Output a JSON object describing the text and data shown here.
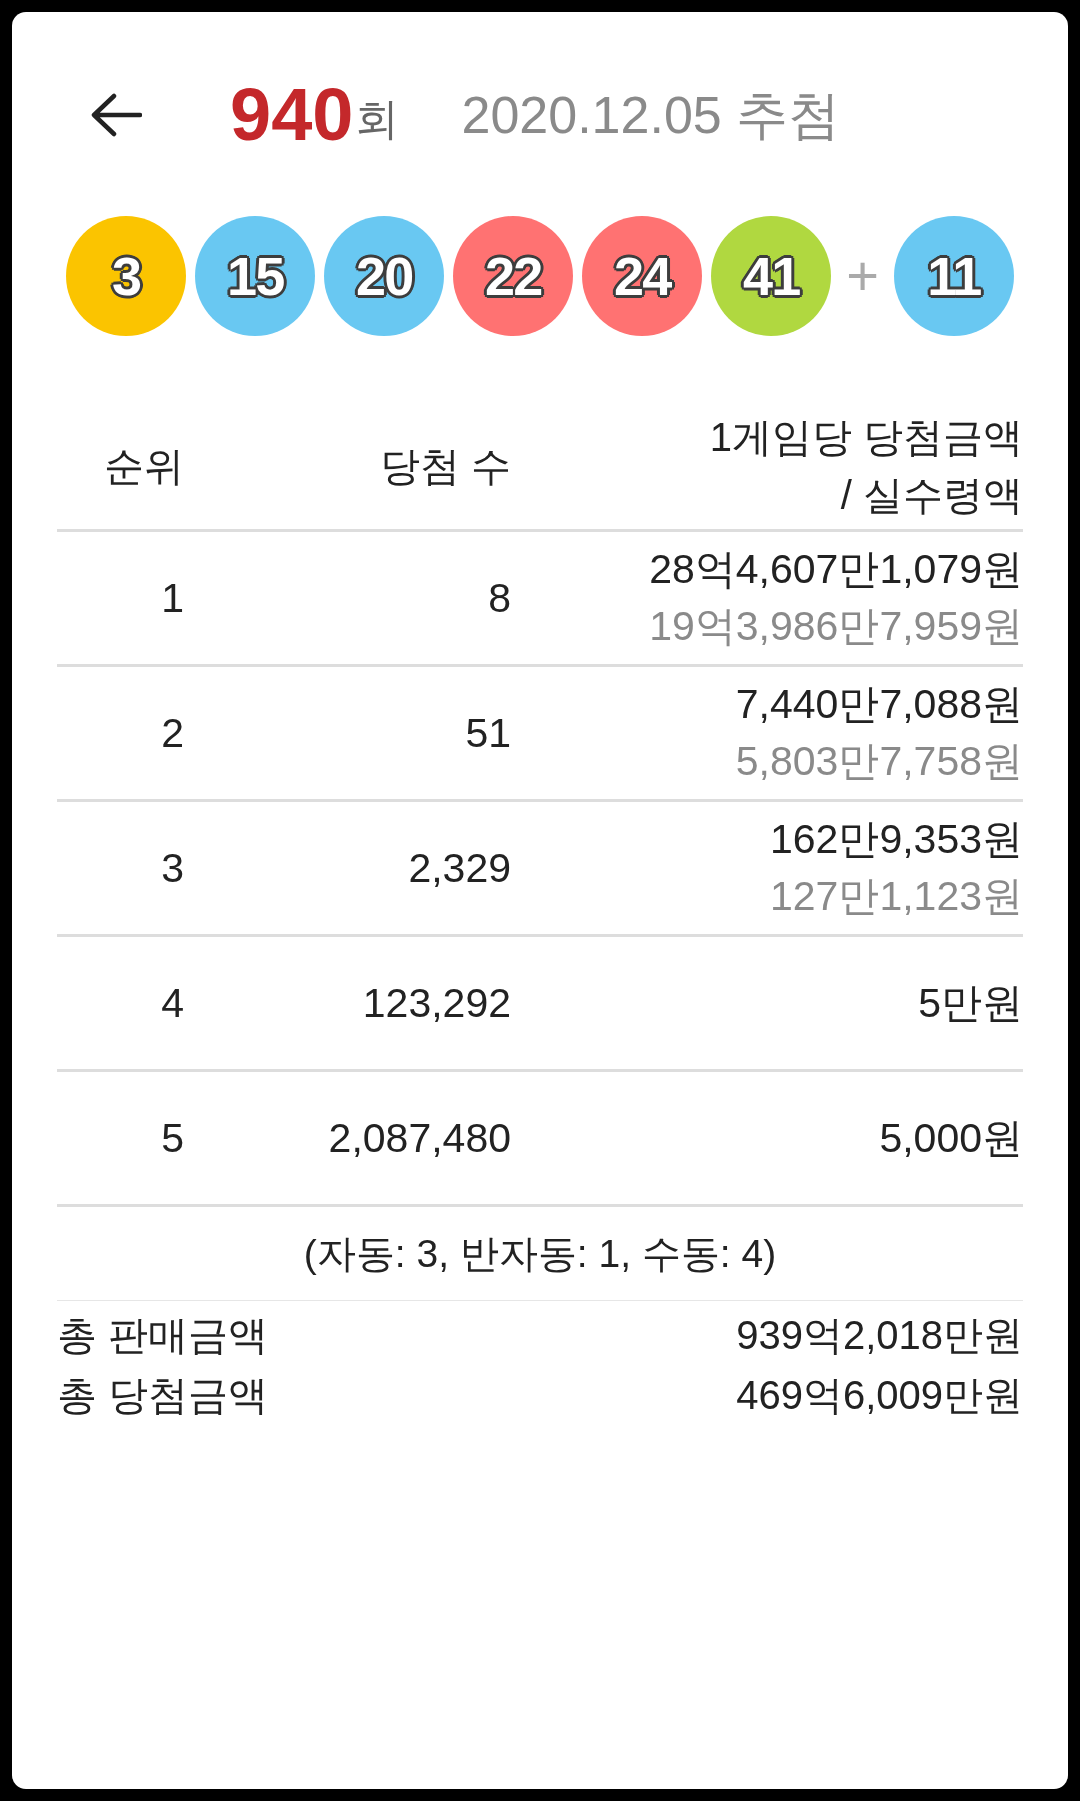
{
  "header": {
    "draw_number": "940",
    "draw_suffix": "회",
    "draw_date": "2020.12.05 추첨"
  },
  "balls": [
    {
      "number": "3",
      "color": "#fbc400"
    },
    {
      "number": "15",
      "color": "#69c8f2"
    },
    {
      "number": "20",
      "color": "#69c8f2"
    },
    {
      "number": "22",
      "color": "#ff7272"
    },
    {
      "number": "24",
      "color": "#ff7272"
    },
    {
      "number": "41",
      "color": "#b0d840"
    }
  ],
  "bonus_separator": "+",
  "bonus_ball": {
    "number": "11",
    "color": "#69c8f2"
  },
  "table": {
    "columns": [
      "순위",
      "당첨 수",
      "1게임당 당첨금액\n/ 실수령액"
    ],
    "rows": [
      {
        "rank": "1",
        "winners": "8",
        "prize": "28억4,607만1,079원",
        "after_tax": "19억3,986만7,959원"
      },
      {
        "rank": "2",
        "winners": "51",
        "prize": "7,440만7,088원",
        "after_tax": "5,803만7,758원"
      },
      {
        "rank": "3",
        "winners": "2,329",
        "prize": "162만9,353원",
        "after_tax": "127만1,123원"
      },
      {
        "rank": "4",
        "winners": "123,292",
        "prize": "5만원"
      },
      {
        "rank": "5",
        "winners": "2,087,480",
        "prize": "5,000원"
      }
    ]
  },
  "selection_note": "(자동: 3, 반자동: 1, 수동: 4)",
  "totals": [
    {
      "label": "총 판매금액",
      "value": "939억2,018만원"
    },
    {
      "label": "총 당첨금액",
      "value": "469억6,009만원"
    }
  ]
}
